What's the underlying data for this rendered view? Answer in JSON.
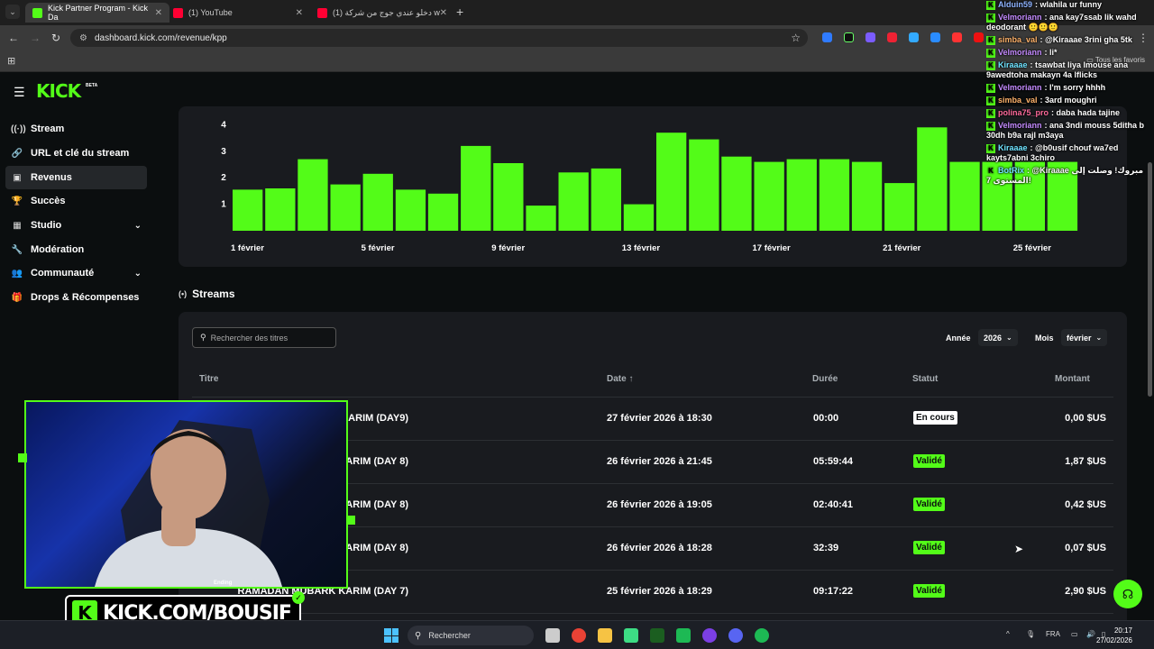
{
  "browser": {
    "tabs": [
      {
        "title": "Kick Partner Program - Kick Da",
        "active": true,
        "favicon_color": "#53fc18"
      },
      {
        "title": "(1) YouTube",
        "active": false,
        "favicon_color": "#ff0033"
      },
      {
        "title": "(1) دخلو عندي جوج من شركة wi",
        "active": false,
        "favicon_color": "#ff0033"
      }
    ],
    "url": "dashboard.kick.com/revenue/kpp",
    "bookmarks_label": "Tous les favoris"
  },
  "sidebar": {
    "logo": "KICK",
    "logo_badge": "BETA",
    "items": [
      {
        "label": "Stream",
        "icon": "broadcast-icon",
        "glyph": "((·))",
        "active": false
      },
      {
        "label": "URL et clé du stream",
        "icon": "link-icon",
        "glyph": "🔗",
        "active": false
      },
      {
        "label": "Revenus",
        "icon": "wallet-icon",
        "glyph": "▣",
        "active": true
      },
      {
        "label": "Succès",
        "icon": "trophy-icon",
        "glyph": "🏆",
        "active": false
      },
      {
        "label": "Studio",
        "icon": "studio-icon",
        "glyph": "▦",
        "active": false,
        "expandable": true
      },
      {
        "label": "Modération",
        "icon": "wrench-icon",
        "glyph": "🔧",
        "active": false
      },
      {
        "label": "Communauté",
        "icon": "community-icon",
        "glyph": "👥",
        "active": false,
        "expandable": true
      },
      {
        "label": "Drops & Récompenses",
        "icon": "gift-icon",
        "glyph": "🎁",
        "active": false
      }
    ]
  },
  "chart_data": {
    "type": "bar",
    "categories": [
      "1 février",
      "2 février",
      "3 février",
      "4 février",
      "5 février",
      "6 février",
      "7 février",
      "8 février",
      "9 février",
      "10 février",
      "11 février",
      "12 février",
      "13 février",
      "14 février",
      "15 février",
      "16 février",
      "17 février",
      "18 février",
      "19 février",
      "20 février",
      "21 février",
      "22 février",
      "23 février",
      "24 février",
      "25 février",
      "26 février"
    ],
    "values": [
      1.55,
      1.6,
      2.7,
      1.75,
      2.15,
      1.55,
      1.4,
      3.2,
      2.55,
      0.95,
      2.2,
      2.35,
      1.0,
      3.7,
      3.45,
      2.8,
      2.6,
      2.7,
      2.7,
      2.6,
      1.8,
      3.9,
      2.6,
      2.6,
      2.6,
      2.6
    ],
    "tick_labels": [
      "1 février",
      "5 février",
      "9 février",
      "13 février",
      "17 février",
      "21 février",
      "25 février"
    ],
    "y_ticks": [
      "1",
      "2",
      "3",
      "4"
    ],
    "ylim": [
      0,
      4.15
    ],
    "bar_color": "#53fc18",
    "grid": false
  },
  "streams": {
    "heading": "Streams",
    "search_placeholder": "Rechercher des titres",
    "year_label": "Année",
    "year_value": "2026",
    "month_label": "Mois",
    "month_value": "février",
    "columns": {
      "title": "Titre",
      "date": "Date",
      "date_sort": "↑",
      "duration": "Durée",
      "status": "Statut",
      "amount": "Montant"
    },
    "rows": [
      {
        "title": "KARIM (DAY9)",
        "date": "27 février 2026 à 18:30",
        "duration": "00:00",
        "status": "En cours",
        "status_kind": "live",
        "amount": "0,00 $US"
      },
      {
        "title": "KARIM (DAY 8)",
        "date": "26 février 2026 à 21:45",
        "duration": "05:59:44",
        "status": "Validé",
        "status_kind": "ok",
        "amount": "1,87 $US"
      },
      {
        "title": "KARIM (DAY 8)",
        "date": "26 février 2026 à 19:05",
        "duration": "02:40:41",
        "status": "Validé",
        "status_kind": "ok",
        "amount": "0,42 $US"
      },
      {
        "title": "KARIM (DAY 8)",
        "date": "26 février 2026 à 18:28",
        "duration": "32:39",
        "status": "Validé",
        "status_kind": "ok",
        "amount": "0,07 $US"
      },
      {
        "title": "RAMADAN MUBARK KARIM (DAY 7)",
        "date": "25 février 2026 à 18:29",
        "duration": "09:17:22",
        "status": "Validé",
        "status_kind": "ok",
        "amount": "2,90 $US"
      }
    ]
  },
  "chat": [
    {
      "user": "Alduin59",
      "color": "#8fb4ff",
      "text": "wlahila ur funny"
    },
    {
      "user": "Velmoriann",
      "color": "#c48bff",
      "text": "ana kay7ssab lik wahd deodorant 🙂🙂🙂"
    },
    {
      "user": "simba_val",
      "color": "#ffb36b",
      "text": "@Kiraaae 3rini gha 5tk"
    },
    {
      "user": "Velmoriann",
      "color": "#c48bff",
      "text": "li*"
    },
    {
      "user": "Kiraaae",
      "color": "#6fe3ff",
      "text": "tsawbat liya lmouse ana 9awedtoha makayn 4a lflicks"
    },
    {
      "user": "Velmoriann",
      "color": "#c48bff",
      "text": "I'm sorry hhhh"
    },
    {
      "user": "simba_val",
      "color": "#ffb36b",
      "text": "3ard moughri"
    },
    {
      "user": "polina75_pro",
      "color": "#ff6b9d",
      "text": "daba hada tajine"
    },
    {
      "user": "Velmoriann",
      "color": "#c48bff",
      "text": "ana 3ndi mouss 5ditha b 30dh b9a rajl m3aya"
    },
    {
      "user": "Kiraaae",
      "color": "#6fe3ff",
      "text": "@b0usif chouf wa7ed kayts7abni 3chiro"
    },
    {
      "user": "BotRix",
      "color": "#6fe3ff",
      "text": "@Kiraaae مبروك! وصلت إلى المستوى 7!"
    }
  ],
  "overlay": {
    "banner_text": "KICK.COM/BOUSIF",
    "cam_tag": "Ending"
  },
  "taskbar": {
    "search_label": "Rechercher",
    "lang": "FRA",
    "time": "20:17",
    "date": "27/02/2026"
  }
}
